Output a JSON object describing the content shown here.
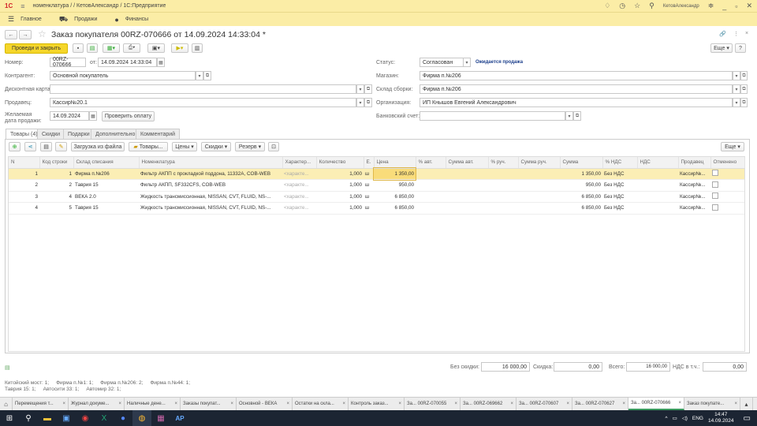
{
  "titlebar": {
    "path": "номенклатура / / КетовАлександр / 1С:Предприятие",
    "user": "КетовАлександр"
  },
  "menu": [
    {
      "label": "Главное",
      "icon": "hamburger-icon"
    },
    {
      "label": "Продажи",
      "icon": "cart-icon"
    },
    {
      "label": "Финансы",
      "icon": "coin-icon"
    }
  ],
  "doc": {
    "title": "Заказ покупателя 00RZ-070666 от 14.09.2024 14:33:04 *",
    "post_close": "Проведи и закрыть",
    "more": "Еще",
    "help": "?"
  },
  "fields": {
    "number_label": "Номер:",
    "number": "00RZ-070666",
    "from_label": "от:",
    "date": "14.09.2024 14:33:04",
    "contractor_label": "Контрагент:",
    "contractor": "Основной покупатель",
    "card_label": "Дисконтная карта:",
    "card": "",
    "seller_label": "Продавец:",
    "seller": "Кассир№20.1",
    "wish_label": "Желаемая дата продажи:",
    "wish_date": "14.09.2024",
    "check_payment": "Проверить оплату",
    "status_label": "Статус:",
    "status": "Согласован",
    "status_note": "Ожидается продажа",
    "shop_label": "Магазин:",
    "shop": "Фирма п.№206",
    "warehouse_label": "Склад сборки:",
    "warehouse": "Фирма п.№206",
    "org_label": "Организация:",
    "org": "ИП Кнышов Евгений Александрович",
    "bank_label": "Банковский счет:",
    "bank": ""
  },
  "tabs": [
    "Товары (4)",
    "Скидки",
    "Подарки",
    "Дополнительно",
    "Комментарий"
  ],
  "table_toolbar": {
    "load": "Загрузка из файла",
    "goods": "Товары...",
    "prices": "Цены",
    "discounts": "Скидки",
    "reserve": "Резерв",
    "more": "Еще"
  },
  "columns": [
    "N",
    "Код строки",
    "Склад списания",
    "Номенклатура",
    "Характер...",
    "Количество",
    "Е.",
    "Цена",
    "% авт.",
    "Сумма авт.",
    "% руч.",
    "Сумма руч.",
    "Сумма",
    "% НДС",
    "НДС",
    "Продавец",
    "Отменено"
  ],
  "rows": [
    [
      "1",
      "1",
      "Фирма п.№206",
      "Фильтр АКПП с прокладкой поддона, 11332A, COB-WEB",
      "<характе...",
      "1,000",
      "ш",
      "1 350,00",
      "",
      "",
      "",
      "",
      "1 350,00",
      "Без НДС",
      "",
      "Кассир№...",
      ""
    ],
    [
      "2",
      "2",
      "Таврия 15",
      "Фильтр АКПП, SF332CFS, COB-WEB",
      "<характе...",
      "1,000",
      "ш",
      "950,00",
      "",
      "",
      "",
      "",
      "950,00",
      "Без НДС",
      "",
      "Кассир№...",
      ""
    ],
    [
      "3",
      "4",
      "ВЕКА 2.0",
      "Жидкость трансмиссионная, NISSAN, CVT, FLUID, NS-...",
      "<характе...",
      "1,000",
      "ш",
      "6 850,00",
      "",
      "",
      "",
      "",
      "6 850,00",
      "Без НДС",
      "",
      "Кассир№...",
      ""
    ],
    [
      "4",
      "5",
      "Таврия 15",
      "Жидкость трансмиссионная, NISSAN, CVT, FLUID, NS-...",
      "<характе...",
      "1,000",
      "ш",
      "6 850,00",
      "",
      "",
      "",
      "",
      "6 850,00",
      "Без НДС",
      "",
      "Кассир№...",
      ""
    ]
  ],
  "totals": {
    "no_disc_label": "Без скидки:",
    "no_disc": "16 000,00",
    "disc_label": "Скидка:",
    "disc": "0,00",
    "total_label": "Всего:",
    "total": "16 000,00",
    "vat_label": "НДС в т.ч.:",
    "vat": "0,00"
  },
  "stock_line1": "Китойский мост: 1;     Фирма п.№1: 1;     Фирма п.№206: 2;     Фирма п.№44: 1;",
  "stock_line2": "Таврия 15: 1;     Автосити 33: 1;     Автомир 32: 1;",
  "window_tabs": [
    "Перемещения т...",
    "Журнал докуме...",
    "Наличные дене...",
    "Заказы покупат...",
    "Основной - ВЕКА",
    "Остатки на скла...",
    "Контроль заказ...",
    "За... 00RZ-070055",
    "За... 00RZ-069662",
    "За... 00RZ-070607",
    "За... 00RZ-070627",
    "За... 00RZ-070666",
    "Заказ покупате..."
  ],
  "active_window_tab": 11,
  "clock": {
    "time": "14:47",
    "date": "14.09.2024",
    "lang": "ENG"
  },
  "colors": {
    "accent": "#fbeda6",
    "button": "#f5d62a",
    "selected_row": "#fbeeb5"
  }
}
